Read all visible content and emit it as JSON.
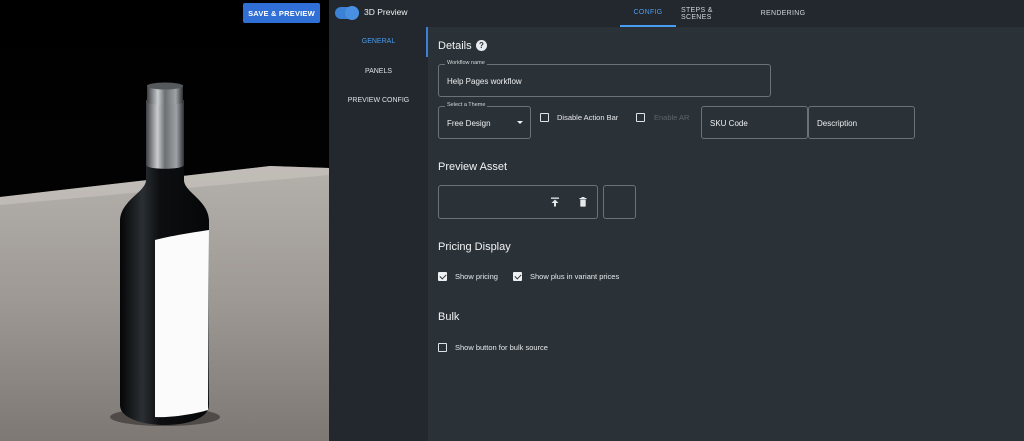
{
  "toolbar": {
    "save_preview_label": "SAVE & PREVIEW"
  },
  "preview_toggle": {
    "label": "3D Preview",
    "enabled": true
  },
  "tabs": [
    {
      "label": "CONFIG",
      "active": true
    },
    {
      "label": "STEPS & SCENES",
      "active": false
    },
    {
      "label": "RENDERING",
      "active": false
    }
  ],
  "subnav": [
    {
      "label": "GENERAL",
      "active": true
    },
    {
      "label": "PANELS",
      "active": false
    },
    {
      "label": "PREVIEW CONFIG",
      "active": false
    }
  ],
  "details": {
    "title": "Details",
    "workflow_name_label": "Workflow name",
    "workflow_name_value": "Help Pages workflow",
    "theme_label": "Select a Theme",
    "theme_value": "Free Design",
    "disable_action_bar_label": "Disable Action Bar",
    "disable_action_bar_checked": false,
    "enable_ar_label": "Enable AR",
    "enable_ar_checked": false,
    "sku_placeholder": "SKU Code",
    "description_placeholder": "Description"
  },
  "preview_asset": {
    "title": "Preview Asset"
  },
  "pricing": {
    "title": "Pricing Display",
    "show_pricing_label": "Show pricing",
    "show_pricing_checked": true,
    "show_plus_label": "Show plus in variant prices",
    "show_plus_checked": true
  },
  "bulk": {
    "title": "Bulk",
    "show_button_label": "Show button for bulk source",
    "show_button_checked": false
  },
  "colors": {
    "accent": "#3b82d6",
    "panel": "#2b3237",
    "sidebar": "#22282d"
  }
}
